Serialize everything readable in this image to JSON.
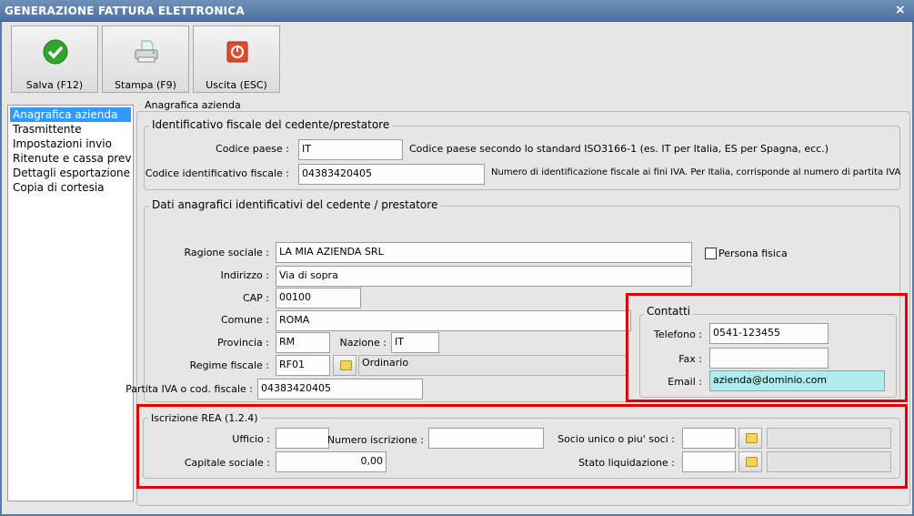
{
  "window": {
    "title": "GENERAZIONE FATTURA ELETTRONICA",
    "close": "×"
  },
  "toolbar": {
    "save_label": "Salva (F12)",
    "print_label": "Stampa (F9)",
    "exit_label": "Uscita (ESC)"
  },
  "sidebar": {
    "items": [
      {
        "label": "Anagrafica azienda",
        "selected": true
      },
      {
        "label": "Trasmittente"
      },
      {
        "label": "Impostazioni invio"
      },
      {
        "label": "Ritenute e cassa previdenziale"
      },
      {
        "label": "Dettagli esportazione"
      },
      {
        "label": "Copia di cortesia"
      }
    ]
  },
  "main": {
    "legend": "Anagrafica azienda",
    "fiscal": {
      "legend": "Identificativo fiscale del cedente/prestatore",
      "country_label": "Codice paese :",
      "country_value": "IT",
      "country_desc": "Codice paese secondo lo standard ISO3166-1 (es. IT per Italia, ES per Spagna, ecc.)",
      "taxid_label": "Codice identificativo fiscale :",
      "taxid_value": "04383420405",
      "taxid_desc": "Numero di identificazione fiscale ai fini IVA. Per Italia, corrisponde al numero di partita IVA"
    },
    "registry": {
      "legend": "Dati anagrafici identificativi del cedente / prestatore",
      "ragione_label": "Ragione sociale :",
      "ragione_value": "LA MIA AZIENDA SRL",
      "persona_label": "Persona fisica",
      "persona_checked": false,
      "indirizzo_label": "Indirizzo :",
      "indirizzo_value": "Via di sopra",
      "cap_label": "CAP :",
      "cap_value": "00100",
      "comune_label": "Comune :",
      "comune_value": "ROMA",
      "provincia_label": "Provincia :",
      "provincia_value": "RM",
      "nazione_label": "Nazione :",
      "nazione_value": "IT",
      "regime_label": "Regime fiscale :",
      "regime_value": "RF01",
      "regime_desc": "Ordinario",
      "piva_label": "Partita IVA o cod. fiscale :",
      "piva_value": "04383420405"
    },
    "contacts": {
      "legend": "Contatti",
      "phone_label": "Telefono :",
      "phone_value": "0541-123455",
      "fax_label": "Fax :",
      "fax_value": "",
      "email_label": "Email :",
      "email_value": "azienda@dominio.com"
    },
    "rea": {
      "legend": "Iscrizione REA (1.2.4)",
      "ufficio_label": "Ufficio :",
      "ufficio_value": "",
      "numero_label": "Numero iscrizione :",
      "numero_value": "",
      "socio_label": "Socio unico o piu' soci :",
      "socio_value": "",
      "socio_desc": "",
      "capitale_label": "Capitale sociale :",
      "capitale_value": "0,00",
      "stato_label": "Stato liquidazione :",
      "stato_value": "",
      "stato_desc": ""
    }
  },
  "colors": {
    "highlight": "#e00000",
    "selection": "#3399ff",
    "email_bg": "#aeeeee"
  }
}
